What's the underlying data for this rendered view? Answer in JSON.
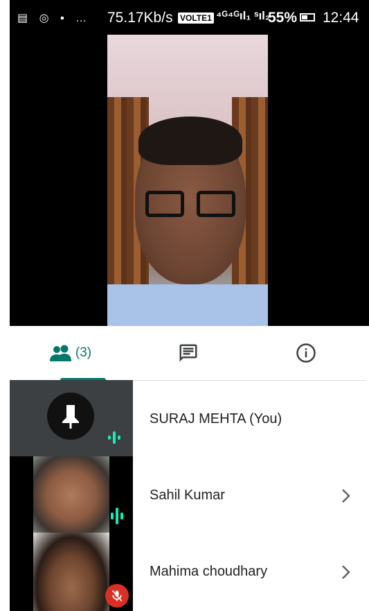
{
  "status_bar": {
    "left_icons": "▤ ◎ ▪ …",
    "net_speed": "75.17Kb/s",
    "volte": "VOLTE1",
    "signal": "⁴ᴳ⁴ᴳıl₁ ˢıl₂",
    "battery_pct": "55%",
    "time": "12:44"
  },
  "tabs": {
    "people_count": "(3)",
    "people_icon": "people-icon",
    "chat_icon": "chat-icon",
    "info_icon": "info-icon",
    "accent_color": "#00796b"
  },
  "participants": [
    {
      "name": "SURAJ MEHTA (You)",
      "speaking": true,
      "muted": false
    },
    {
      "name": "Sahil Kumar",
      "speaking": true,
      "muted": false
    },
    {
      "name": "Mahima choudhary",
      "speaking": false,
      "muted": true
    }
  ]
}
